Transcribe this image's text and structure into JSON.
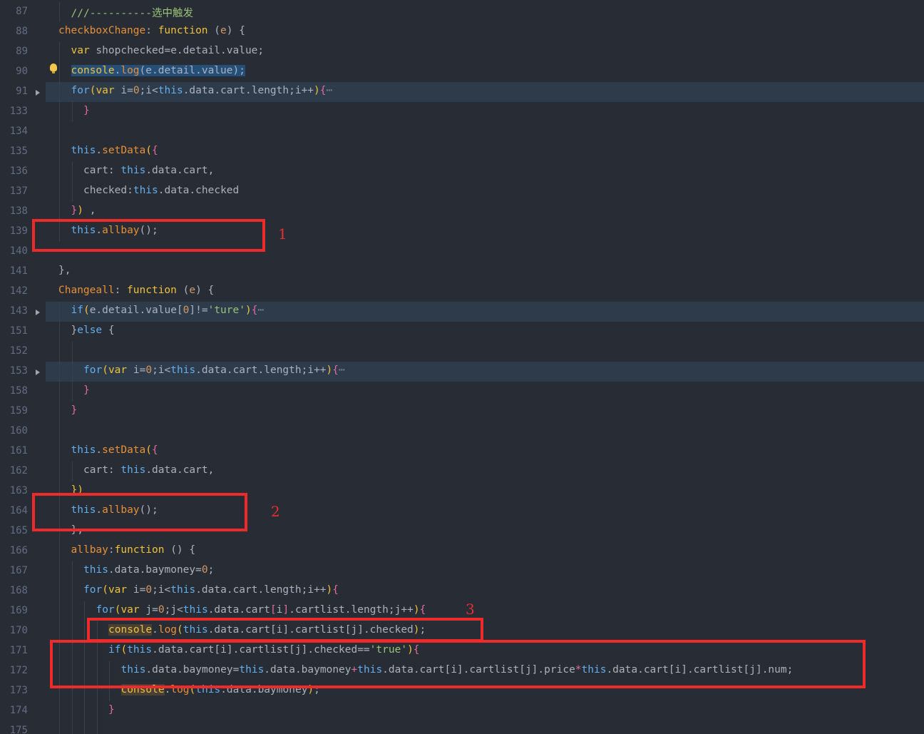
{
  "editor": {
    "lines": [
      {
        "ln": "87",
        "indent": 2,
        "hl": false,
        "fold": false,
        "tokens": [
          {
            "t": "///----------选中触发",
            "c": "c"
          }
        ]
      },
      {
        "ln": "88",
        "indent": 1,
        "hl": false,
        "fold": false,
        "tokens": [
          {
            "t": "checkboxChange",
            "c": "fn"
          },
          {
            "t": ": ",
            "c": ""
          },
          {
            "t": "function",
            "c": "kw"
          },
          {
            "t": " (",
            "c": ""
          },
          {
            "t": "e",
            "c": "par"
          },
          {
            "t": ") {",
            "c": ""
          }
        ]
      },
      {
        "ln": "89",
        "indent": 2,
        "hl": false,
        "fold": false,
        "tokens": [
          {
            "t": "var",
            "c": "kw"
          },
          {
            "t": " shopchecked=e.detail.value;",
            "c": ""
          }
        ]
      },
      {
        "ln": "90",
        "indent": 2,
        "hl": false,
        "fold": false,
        "bulb": true,
        "tokens": [
          {
            "t": "console",
            "c": "kw sel"
          },
          {
            "t": ".",
            "c": "sel"
          },
          {
            "t": "log",
            "c": "fn sel"
          },
          {
            "t": "(e.detail.value);",
            "c": "sel"
          }
        ]
      },
      {
        "ln": "91",
        "indent": 2,
        "hl": true,
        "fold": true,
        "tokens": [
          {
            "t": "for",
            "c": "t"
          },
          {
            "t": "(",
            "c": "p"
          },
          {
            "t": "var",
            "c": "kw"
          },
          {
            "t": " i=",
            "c": ""
          },
          {
            "t": "0",
            "c": "n"
          },
          {
            "t": ";i<",
            "c": ""
          },
          {
            "t": "this",
            "c": "t"
          },
          {
            "t": ".data.cart.length;i++",
            "c": ""
          },
          {
            "t": ")",
            "c": "p"
          },
          {
            "t": "{",
            "c": "pk"
          },
          {
            "t": "⋯",
            "c": "fb"
          }
        ]
      },
      {
        "ln": "133",
        "indent": 3,
        "hl": false,
        "fold": false,
        "tokens": [
          {
            "t": "}",
            "c": "pk"
          }
        ]
      },
      {
        "ln": "134",
        "indent": 2,
        "hl": false,
        "fold": false,
        "tokens": []
      },
      {
        "ln": "135",
        "indent": 2,
        "hl": false,
        "fold": false,
        "tokens": [
          {
            "t": "this",
            "c": "t"
          },
          {
            "t": ".",
            "c": ""
          },
          {
            "t": "setData",
            "c": "fn"
          },
          {
            "t": "(",
            "c": "p"
          },
          {
            "t": "{",
            "c": "pk"
          }
        ]
      },
      {
        "ln": "136",
        "indent": 3,
        "hl": false,
        "fold": false,
        "tokens": [
          {
            "t": "cart: ",
            "c": ""
          },
          {
            "t": "this",
            "c": "t"
          },
          {
            "t": ".data.cart,",
            "c": ""
          }
        ]
      },
      {
        "ln": "137",
        "indent": 3,
        "hl": false,
        "fold": false,
        "tokens": [
          {
            "t": "checked:",
            "c": ""
          },
          {
            "t": "this",
            "c": "t"
          },
          {
            "t": ".data.checked",
            "c": ""
          }
        ]
      },
      {
        "ln": "138",
        "indent": 2,
        "hl": false,
        "fold": false,
        "tokens": [
          {
            "t": "}",
            "c": "pk"
          },
          {
            "t": ")",
            "c": "p"
          },
          {
            "t": " ,",
            "c": ""
          }
        ]
      },
      {
        "ln": "139",
        "indent": 2,
        "hl": false,
        "fold": false,
        "tokens": [
          {
            "t": "this",
            "c": "t"
          },
          {
            "t": ".",
            "c": ""
          },
          {
            "t": "allbay",
            "c": "fn"
          },
          {
            "t": "();",
            "c": ""
          }
        ]
      },
      {
        "ln": "140",
        "indent": 1,
        "hl": false,
        "fold": false,
        "tokens": []
      },
      {
        "ln": "141",
        "indent": 1,
        "hl": false,
        "fold": false,
        "tokens": [
          {
            "t": "},",
            "c": ""
          }
        ]
      },
      {
        "ln": "142",
        "indent": 1,
        "hl": false,
        "fold": false,
        "tokens": [
          {
            "t": "Changeall",
            "c": "fn"
          },
          {
            "t": ": ",
            "c": ""
          },
          {
            "t": "function",
            "c": "kw"
          },
          {
            "t": " (",
            "c": ""
          },
          {
            "t": "e",
            "c": "par"
          },
          {
            "t": ") {",
            "c": ""
          }
        ]
      },
      {
        "ln": "143",
        "indent": 2,
        "hl": true,
        "fold": true,
        "tokens": [
          {
            "t": "if",
            "c": "t"
          },
          {
            "t": "(",
            "c": "p"
          },
          {
            "t": "e.detail.value[",
            "c": ""
          },
          {
            "t": "0",
            "c": "n"
          },
          {
            "t": "]!=",
            "c": ""
          },
          {
            "t": "'ture'",
            "c": "s"
          },
          {
            "t": ")",
            "c": "p"
          },
          {
            "t": "{",
            "c": "pk"
          },
          {
            "t": "⋯",
            "c": "fb"
          }
        ]
      },
      {
        "ln": "151",
        "indent": 2,
        "hl": false,
        "fold": false,
        "tokens": [
          {
            "t": "}",
            "c": ""
          },
          {
            "t": "else",
            "c": "t"
          },
          {
            "t": " {",
            "c": ""
          }
        ]
      },
      {
        "ln": "152",
        "indent": 3,
        "hl": false,
        "fold": false,
        "tokens": []
      },
      {
        "ln": "153",
        "indent": 3,
        "hl": true,
        "fold": true,
        "tokens": [
          {
            "t": "for",
            "c": "t"
          },
          {
            "t": "(",
            "c": "p"
          },
          {
            "t": "var",
            "c": "kw"
          },
          {
            "t": " i=",
            "c": ""
          },
          {
            "t": "0",
            "c": "n"
          },
          {
            "t": ";i<",
            "c": ""
          },
          {
            "t": "this",
            "c": "t"
          },
          {
            "t": ".data.cart.length;i++",
            "c": ""
          },
          {
            "t": ")",
            "c": "p"
          },
          {
            "t": "{",
            "c": "pk"
          },
          {
            "t": "⋯",
            "c": "fb"
          }
        ]
      },
      {
        "ln": "158",
        "indent": 3,
        "hl": false,
        "fold": false,
        "tokens": [
          {
            "t": "}",
            "c": "pk"
          }
        ]
      },
      {
        "ln": "159",
        "indent": 2,
        "hl": false,
        "fold": false,
        "tokens": [
          {
            "t": "}",
            "c": "pk"
          }
        ]
      },
      {
        "ln": "160",
        "indent": 2,
        "hl": false,
        "fold": false,
        "tokens": []
      },
      {
        "ln": "161",
        "indent": 2,
        "hl": false,
        "fold": false,
        "tokens": [
          {
            "t": "this",
            "c": "t"
          },
          {
            "t": ".",
            "c": ""
          },
          {
            "t": "setData",
            "c": "fn"
          },
          {
            "t": "(",
            "c": "p"
          },
          {
            "t": "{",
            "c": "pk"
          }
        ]
      },
      {
        "ln": "162",
        "indent": 3,
        "hl": false,
        "fold": false,
        "tokens": [
          {
            "t": "cart: ",
            "c": ""
          },
          {
            "t": "this",
            "c": "t"
          },
          {
            "t": ".data.cart,",
            "c": ""
          }
        ]
      },
      {
        "ln": "163",
        "indent": 2,
        "hl": false,
        "fold": false,
        "tokens": [
          {
            "t": "})",
            "c": "p"
          }
        ]
      },
      {
        "ln": "164",
        "indent": 2,
        "hl": false,
        "fold": false,
        "tokens": [
          {
            "t": "this",
            "c": "t"
          },
          {
            "t": ".",
            "c": ""
          },
          {
            "t": "allbay",
            "c": "fn"
          },
          {
            "t": "();",
            "c": ""
          }
        ]
      },
      {
        "ln": "165",
        "indent": 2,
        "hl": false,
        "fold": false,
        "tokens": [
          {
            "t": "},",
            "c": ""
          }
        ]
      },
      {
        "ln": "166",
        "indent": 2,
        "hl": false,
        "fold": false,
        "tokens": [
          {
            "t": "allbay",
            "c": "fn"
          },
          {
            "t": ":",
            "c": ""
          },
          {
            "t": "function",
            "c": "kw"
          },
          {
            "t": " () {",
            "c": ""
          }
        ]
      },
      {
        "ln": "167",
        "indent": 3,
        "hl": false,
        "fold": false,
        "tokens": [
          {
            "t": "this",
            "c": "t"
          },
          {
            "t": ".data.baymoney=",
            "c": ""
          },
          {
            "t": "0",
            "c": "n"
          },
          {
            "t": ";",
            "c": ""
          }
        ]
      },
      {
        "ln": "168",
        "indent": 3,
        "hl": false,
        "fold": false,
        "tokens": [
          {
            "t": "for",
            "c": "t"
          },
          {
            "t": "(",
            "c": "p"
          },
          {
            "t": "var",
            "c": "kw"
          },
          {
            "t": " i=",
            "c": ""
          },
          {
            "t": "0",
            "c": "n"
          },
          {
            "t": ";i<",
            "c": ""
          },
          {
            "t": "this",
            "c": "t"
          },
          {
            "t": ".data.cart.length;i++",
            "c": ""
          },
          {
            "t": ")",
            "c": "p"
          },
          {
            "t": "{",
            "c": "pk"
          }
        ]
      },
      {
        "ln": "169",
        "indent": 4,
        "hl": false,
        "fold": false,
        "tokens": [
          {
            "t": "for",
            "c": "t"
          },
          {
            "t": "(",
            "c": "p"
          },
          {
            "t": "var",
            "c": "kw"
          },
          {
            "t": " j=",
            "c": ""
          },
          {
            "t": "0",
            "c": "n"
          },
          {
            "t": ";j<",
            "c": ""
          },
          {
            "t": "this",
            "c": "t"
          },
          {
            "t": ".data.cart",
            "c": ""
          },
          {
            "t": "[",
            "c": "pk"
          },
          {
            "t": "i",
            "c": ""
          },
          {
            "t": "]",
            "c": "pk"
          },
          {
            "t": ".cartlist.length;j++",
            "c": ""
          },
          {
            "t": ")",
            "c": "p"
          },
          {
            "t": "{",
            "c": "pk"
          }
        ]
      },
      {
        "ln": "170",
        "indent": 5,
        "hl": false,
        "fold": false,
        "tokens": [
          {
            "t": "console",
            "c": "kw wb"
          },
          {
            "t": ".",
            "c": ""
          },
          {
            "t": "log",
            "c": "fn"
          },
          {
            "t": "(",
            "c": "p"
          },
          {
            "t": "this",
            "c": "t"
          },
          {
            "t": ".data.cart[i].cartlist[j].checked",
            "c": ""
          },
          {
            "t": ")",
            "c": "p"
          },
          {
            "t": ";",
            "c": ""
          }
        ]
      },
      {
        "ln": "171",
        "indent": 5,
        "hl": false,
        "fold": false,
        "tokens": [
          {
            "t": "if",
            "c": "t"
          },
          {
            "t": "(",
            "c": "p"
          },
          {
            "t": "this",
            "c": "t"
          },
          {
            "t": ".data.cart[i].cartlist[j].checked==",
            "c": ""
          },
          {
            "t": "'true'",
            "c": "s"
          },
          {
            "t": ")",
            "c": "p"
          },
          {
            "t": "{",
            "c": "pk"
          }
        ]
      },
      {
        "ln": "172",
        "indent": 6,
        "hl": false,
        "fold": false,
        "tokens": [
          {
            "t": "this",
            "c": "t"
          },
          {
            "t": ".data.baymoney=",
            "c": ""
          },
          {
            "t": "this",
            "c": "t"
          },
          {
            "t": ".data.baymoney",
            "c": ""
          },
          {
            "t": "+",
            "c": "pk"
          },
          {
            "t": "this",
            "c": "t"
          },
          {
            "t": ".data.cart[i].cartlist[j].price",
            "c": ""
          },
          {
            "t": "*",
            "c": "pk"
          },
          {
            "t": "this",
            "c": "t"
          },
          {
            "t": ".data.cart[i].cartlist[j].num;",
            "c": ""
          }
        ]
      },
      {
        "ln": "173",
        "indent": 6,
        "hl": false,
        "fold": false,
        "tokens": [
          {
            "t": "console",
            "c": "kw wb"
          },
          {
            "t": ".",
            "c": ""
          },
          {
            "t": "log",
            "c": "fn"
          },
          {
            "t": "(",
            "c": "p"
          },
          {
            "t": "this",
            "c": "t"
          },
          {
            "t": ".data.baymoney",
            "c": ""
          },
          {
            "t": ")",
            "c": "p"
          },
          {
            "t": ";",
            "c": ""
          }
        ]
      },
      {
        "ln": "174",
        "indent": 5,
        "hl": false,
        "fold": false,
        "tokens": [
          {
            "t": "}",
            "c": "pk"
          }
        ]
      },
      {
        "ln": "175",
        "indent": 5,
        "hl": false,
        "fold": false,
        "tokens": []
      }
    ]
  },
  "annotations": {
    "labels": [
      "1",
      "2",
      "3"
    ],
    "color": "#ee2a2a"
  },
  "colors": {
    "background": "#282c34",
    "current_line": "#2e3b4a",
    "line_number": "#636d83",
    "selection": "#264f78"
  }
}
